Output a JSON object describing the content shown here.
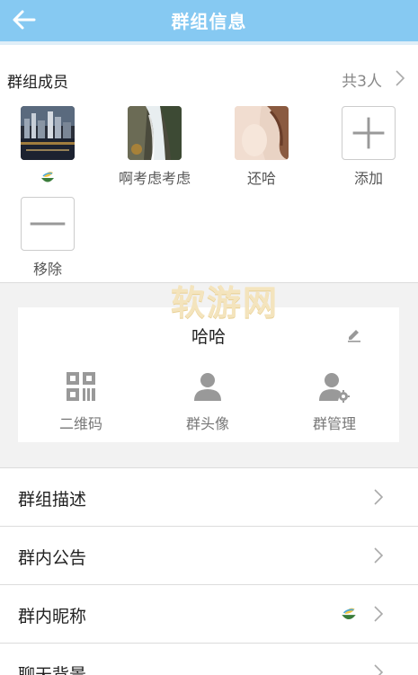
{
  "header": {
    "title": "群组信息",
    "back_icon": "arrow-left-icon"
  },
  "members_section": {
    "label": "群组成员",
    "count_text": "共3人",
    "members": [
      {
        "name": "",
        "avatar": "city-night-photo",
        "name_icon": "leaf-cup-icon"
      },
      {
        "name": "啊考虑考虑",
        "avatar": "waterfall-photo"
      },
      {
        "name": "还哈",
        "avatar": "portrait-photo"
      }
    ],
    "add_label": "添加",
    "remove_label": "移除"
  },
  "watermark": "软游网",
  "group_card": {
    "name": "哈哈",
    "tools": [
      {
        "label": "二维码",
        "icon": "qr-code-icon"
      },
      {
        "label": "群头像",
        "icon": "person-icon"
      },
      {
        "label": "群管理",
        "icon": "person-gear-icon"
      }
    ]
  },
  "settings_rows": [
    {
      "label": "群组描述"
    },
    {
      "label": "群内公告"
    },
    {
      "label": "群内昵称",
      "value_icon": "leaf-cup-icon"
    },
    {
      "label": "聊天背景"
    }
  ],
  "colors": {
    "header_bg": "#86c9f2",
    "page_bg": "#f2f2f2",
    "icon_gray": "#999999"
  }
}
